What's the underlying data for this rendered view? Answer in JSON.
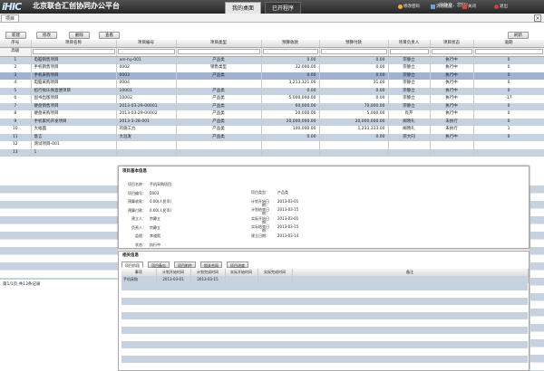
{
  "header": {
    "logo": "iHIC",
    "app_title": "北京联合汇创协同办公平台",
    "tab_desk": "我的桌面",
    "tab_apps": "已开程序",
    "user_label": "宗静立，您好!",
    "links": [
      {
        "icon": "key-icon",
        "label": "修改密码"
      },
      {
        "icon": "message-icon",
        "label": "消息提醒"
      },
      {
        "icon": "close-icon",
        "label": "关闭"
      },
      {
        "icon": "refresh-icon",
        "label": "退出"
      }
    ]
  },
  "module_tab": "项目",
  "close_symbol": "×",
  "toolbar": {
    "new": "新建",
    "modify": "修改",
    "delete": "删除",
    "view": "查看",
    "refresh": "刷新"
  },
  "grid": {
    "headers": [
      "序号",
      "项目名称",
      "项目编号",
      "项目类型",
      "预算收款",
      "预算付款",
      "项目负责人",
      "项目状态",
      "逾期"
    ],
    "filter_label": "高级",
    "rows": [
      [
        "1",
        "电脑销售项目",
        "xm-hy-001",
        "产品类",
        "0.00",
        "0.00",
        "宗静立",
        "执行中",
        "0"
      ],
      [
        "2",
        "手机销售项目",
        "0002",
        "销售类型",
        "32,000.00",
        "0.00",
        "宗静立",
        "执行中",
        "0"
      ],
      [
        "3",
        "手机采购项目",
        "0003",
        "产品类",
        "0.00",
        "0.00",
        "宗静立",
        "执行中",
        "0"
      ],
      [
        "4",
        "电脑采购项目",
        "0004",
        "",
        "3,213,321.00",
        "31.00",
        "宗静立",
        "执行中",
        "0"
      ],
      [
        "5",
        "招行搞乐保直便项目",
        "10001",
        "产品类",
        "0.00",
        "0.00",
        "宗静立",
        "执行中",
        "0"
      ],
      [
        "6",
        "固书出版项目",
        "10002",
        "产品类",
        "5,000,000.00",
        "0.00",
        "宗静立",
        "执行中",
        "-17"
      ],
      [
        "7",
        "硬盘销售项目",
        "2013-03-29-00001",
        "产品类",
        "60,000.00",
        "70,000.00",
        "宗静立",
        "执行中",
        "0"
      ],
      [
        "8",
        "硬盘采购项目",
        "2013-03-29-00002",
        "产品类",
        "20,000.00",
        "5,000.00",
        "肖芹",
        "执行中",
        "0"
      ],
      [
        "9",
        "手机家托开发项目",
        "2013-3-28-001",
        "产品类",
        "20,000,000.00",
        "20,000,000.00",
        "阚晓礼",
        "未执行",
        "0"
      ],
      [
        "10",
        "大幅面",
        "的施工力",
        "产品类",
        "100,000.00",
        "1,233,333.00",
        "阚晓礼",
        "未执行",
        "1"
      ],
      [
        "11",
        "意言",
        "大涯发",
        "产品类",
        "0.00",
        "0.00",
        "宗大同",
        "执行中",
        "0"
      ],
      [
        "12",
        "测试项目-001",
        "",
        "",
        "",
        "",
        "",
        "",
        ""
      ],
      [
        "13",
        "1",
        "",
        "",
        "",
        "",
        "",
        "",
        ""
      ]
    ]
  },
  "pager": "第1/1页 共13条记录",
  "detail": {
    "title": "项目基本信息",
    "left": [
      [
        "项目名称：",
        "手机采购项目"
      ],
      [
        "项目编号：",
        "0003"
      ],
      [
        "预算收款：",
        "0.00(人民币)"
      ],
      [
        "预算付款：",
        "0.00(人民币)"
      ],
      [
        "建立人：",
        "宗静立"
      ],
      [
        "负责人：",
        "宗静立"
      ],
      [
        "监理：",
        "李道熙"
      ],
      [
        "状态：",
        "执行中"
      ]
    ],
    "right": [
      [
        "项目类型：",
        "产品类"
      ],
      [
        "计划开始日期：",
        "2013-03-01"
      ],
      [
        "计划结束日期：",
        "2013-03-15"
      ],
      [
        "实际开始日期：",
        "2013-03-01"
      ],
      [
        "实际结束日期：",
        "2013-03-15"
      ],
      [
        "建立日期：",
        "2013-03-14"
      ]
    ]
  },
  "related": {
    "title": "相关信息",
    "tabs": [
      "项目阶段",
      "项目备忘",
      "项目附件",
      "相关合同",
      "项目进度"
    ],
    "headers": [
      "事项",
      "计划开始时间",
      "计划完成时间",
      "实际开始时间",
      "实际完成时间",
      "备注"
    ],
    "rows": [
      [
        "手机采购",
        "2013-03-01",
        "2013-03-15",
        "",
        "",
        ""
      ]
    ]
  }
}
